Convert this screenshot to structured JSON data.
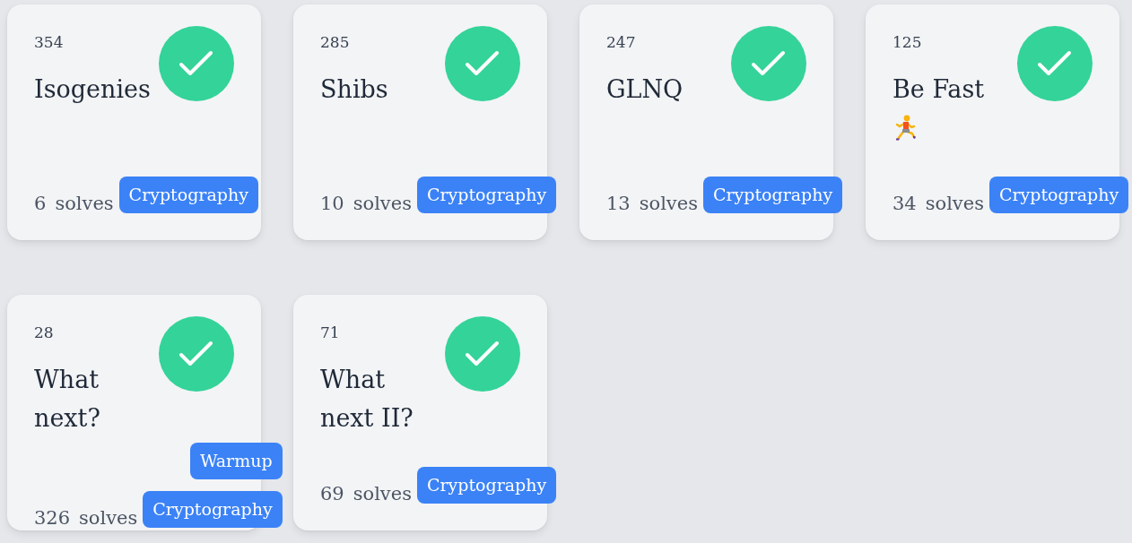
{
  "challenges": [
    {
      "points": "354",
      "title": "Isogenies",
      "solved": true,
      "solves": "6",
      "solves_label": "solves",
      "tags": [
        "Cryptography"
      ]
    },
    {
      "points": "285",
      "title": "Shibs",
      "solved": true,
      "solves": "10",
      "solves_label": "solves",
      "tags": [
        "Cryptography"
      ]
    },
    {
      "points": "247",
      "title": "GLNQ",
      "solved": true,
      "solves": "13",
      "solves_label": "solves",
      "tags": [
        "Cryptography"
      ]
    },
    {
      "points": "125",
      "title": "Be Fast",
      "emoji": true,
      "solved": true,
      "solves": "34",
      "solves_label": "solves",
      "tags": [
        "Cryptography"
      ]
    },
    {
      "points": "28",
      "title": "What next?",
      "solved": true,
      "solves": "326",
      "solves_label": "solves",
      "tags": [
        "Warmup",
        "Cryptography"
      ]
    },
    {
      "points": "71",
      "title": "What next II?",
      "solved": true,
      "solves": "69",
      "solves_label": "solves",
      "tags": [
        "Cryptography"
      ]
    }
  ]
}
